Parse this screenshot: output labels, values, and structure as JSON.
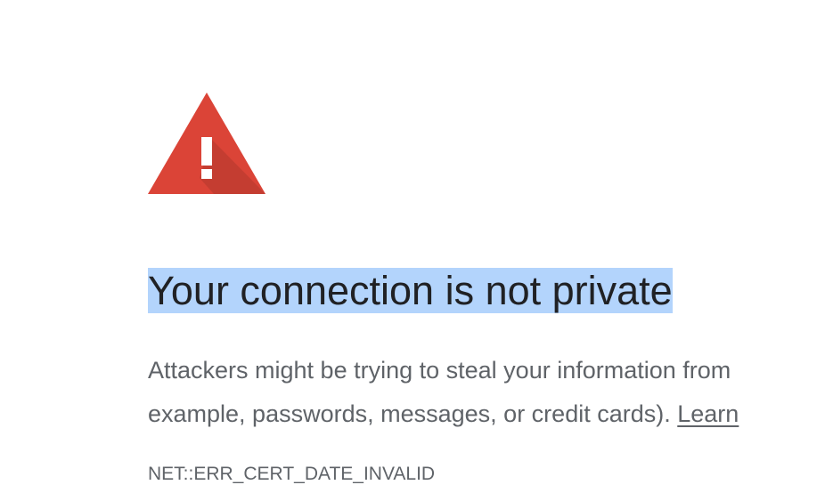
{
  "icons": {
    "warning": "warning-triangle-icon",
    "warning_color": "#db4437"
  },
  "interstitial": {
    "heading": "Your connection is not private",
    "explanation_line1": "Attackers might be trying to steal your information from",
    "explanation_line2": "example, passwords, messages, or credit cards).",
    "learn_more_link": "Learn",
    "error_code": "NET::ERR_CERT_DATE_INVALID"
  },
  "colors": {
    "heading": "#202124",
    "body_text": "#5f6368",
    "selection_highlight": "#b3d4fc",
    "background": "#ffffff"
  }
}
